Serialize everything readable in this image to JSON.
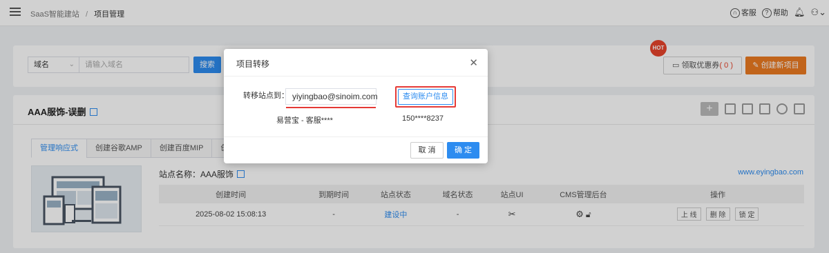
{
  "header": {
    "breadcrumb_root": "SaaS智能建站",
    "breadcrumb_sep": "/",
    "breadcrumb_current": "项目管理",
    "service_label": "客服",
    "help_label": "帮助"
  },
  "search": {
    "select_value": "域名",
    "input_placeholder": "请输入域名",
    "search_label": "搜索",
    "hot_badge": "HOT",
    "coupon_label": "领取优惠券",
    "coupon_count": "( 0 )",
    "create_label": "创建新项目"
  },
  "project": {
    "title": "AAA服饰-误删",
    "tabs": [
      "管理响应式",
      "创建谷歌AMP",
      "创建百度MIP",
      "创"
    ],
    "site_name_label": "站点名称：AAA服饰",
    "site_link": "www.eyingbao.com",
    "columns": [
      "创建时间",
      "到期时间",
      "站点状态",
      "域名状态",
      "站点UI",
      "CMS管理后台",
      "操作"
    ],
    "row": {
      "created": "2025-08-02 15:08:13",
      "expire": "-",
      "status": "建设中",
      "domain_status": "-"
    },
    "ops": [
      "上 线",
      "删 除",
      "锁 定"
    ]
  },
  "modal": {
    "title": "项目转移",
    "field_label": "转移站点到：",
    "email_value": "yiyingbao@sinoim.com",
    "query_label": "查询账户信息",
    "account_name": "易营宝 - 客服****",
    "account_phone": "150****8237",
    "cancel_label": "取 消",
    "ok_label": "确 定"
  },
  "colors": {
    "primary": "#2d8cf0",
    "orange": "#ec7a22",
    "highlight_red": "#e53935"
  }
}
